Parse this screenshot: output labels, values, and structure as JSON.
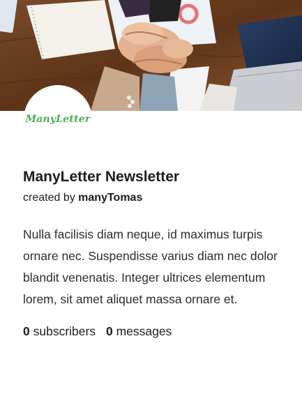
{
  "logo": {
    "text": "ManyLetter"
  },
  "newsletter": {
    "title": "ManyLetter Newsletter",
    "created_by_prefix": "created by",
    "author": "manyTomas",
    "description": "Nulla facilisis diam neque, id maximus turpis ornare nec. Suspendisse varius diam nec dolor blandit venenatis. Integer ultrices elementum lorem, sit amet aliquet massa ornare et.",
    "subscribers_count": "0",
    "subscribers_label": "subscribers",
    "messages_count": "0",
    "messages_label": "messages"
  },
  "colors": {
    "logo_green": "#4caf50",
    "wood": "#6b3e22"
  }
}
